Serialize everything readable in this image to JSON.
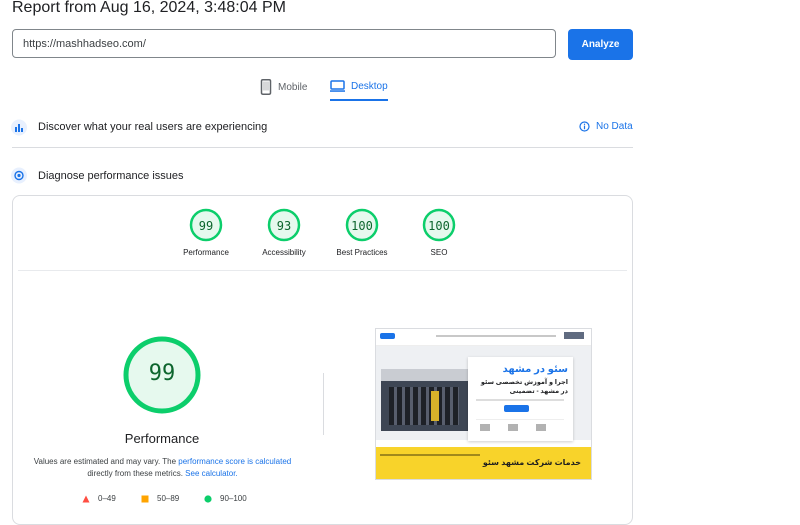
{
  "report": {
    "title": "Report from Aug 16, 2024, 3:48:04 PM"
  },
  "search": {
    "url": "https://mashhadseo.com/",
    "analyze_label": "Analyze"
  },
  "tabs": [
    {
      "label": "Mobile"
    },
    {
      "label": "Desktop"
    }
  ],
  "real_users": {
    "label": "Discover what your real users are experiencing",
    "status": "No Data"
  },
  "diagnose": {
    "label": "Diagnose performance issues"
  },
  "scores": [
    {
      "value": "99",
      "label": "Performance"
    },
    {
      "value": "93",
      "label": "Accessibility"
    },
    {
      "value": "100",
      "label": "Best Practices"
    },
    {
      "value": "100",
      "label": "SEO"
    }
  ],
  "performance": {
    "score": "99",
    "title": "Performance",
    "note_prefix": "Values are estimated and may vary. The ",
    "note_link1": "performance score is calculated",
    "note_middle": " directly from these metrics. ",
    "note_link2": "See calculator."
  },
  "legend": [
    {
      "range": "0–49",
      "color": "#ff4e42"
    },
    {
      "range": "50–89",
      "color": "#ffa400"
    },
    {
      "range": "90–100",
      "color": "#0cce6b"
    }
  ],
  "screenshot": {
    "heading": "سئو در مشهد",
    "subheading": "اجرا و آموزش تخصصی سئو در مشهد - تضمینی",
    "footer_text": "خدمات شرکت مشهد سئو"
  },
  "colors": {
    "accent": "#1a73e8",
    "good": "#0cce6b"
  }
}
